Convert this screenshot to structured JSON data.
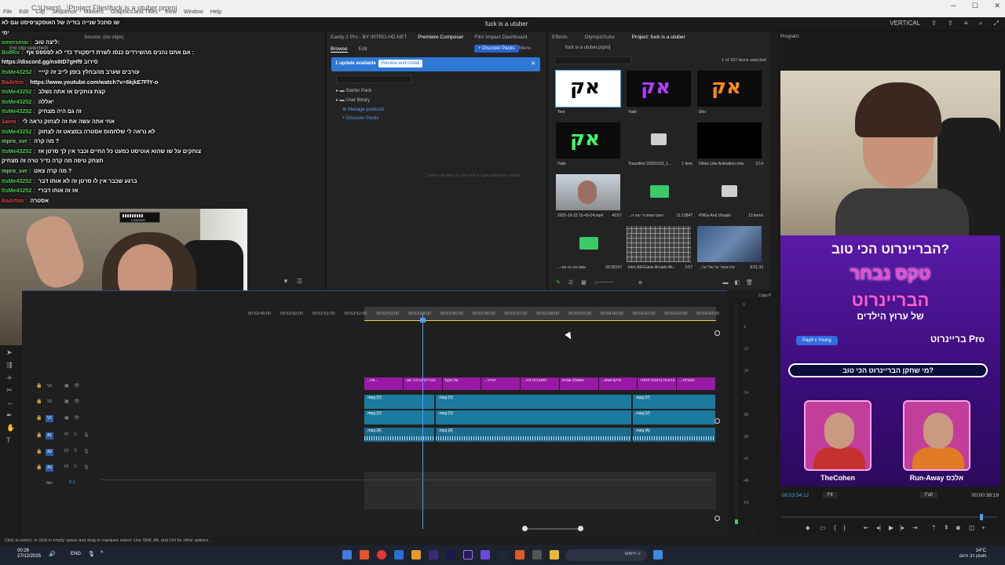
{
  "window": {
    "title": "fuck is a utuber",
    "path": "C:\\Users\\...\\Project Files\\fuck is a utuber.prproj",
    "menu": [
      "File",
      "Edit",
      "Clip",
      "Sequence",
      "Markers",
      "Graphics and Titles",
      "View",
      "Window",
      "Help"
    ],
    "workspace_right": "VERTICAL"
  },
  "chat": [
    {
      "user": "",
      "msg": "שו סתכל שנייה בודיה של האוסקציפיסט וגם לא ",
      "color": "red"
    },
    {
      "user": "",
      "msg": "ימי",
      "color": "red"
    },
    {
      "user": "omersinai",
      "msg": "ליצה טוב:",
      "color": "green"
    },
    {
      "user": "BotRix",
      "msg": "אם אתם נהנים מהשירדים כנסו לשרת דיסקורד כדי לא לפספס אף :",
      "color": "green"
    },
    {
      "user": "",
      "msg": "https://discord.gg/ns6tD7gHf9 סירוב",
      "color": "green"
    },
    {
      "user": "ItsMe43252",
      "msg": "עורבים שערב מהבחלץ בזמן לייב זה קיייי",
      "color": "green"
    },
    {
      "user": "BaArtim",
      "msg": "https://www.youtube.com/watch?v=6kjkE7FfY-o",
      "color": "red"
    },
    {
      "user": "ItsMe43252",
      "msg": "קצת צוחקים אז אתה נשלב",
      "color": "green"
    },
    {
      "user": "ItsMe43252",
      "msg": "יאללה",
      "color": "green"
    },
    {
      "user": "ItsMe43252",
      "msg": "זה גם היה מצחיק",
      "color": "green"
    },
    {
      "user": "1avni",
      "msg": "אחי אתה עשה את זה לצחוק נראה לי",
      "color": "red"
    },
    {
      "user": "ItsMe43252",
      "msg": "לא נראה לי שלחמוס אסטרה במצאט זה לצחוק",
      "color": "green"
    },
    {
      "user": "mpro_svr",
      "msg": "מה קרה ?",
      "color": "green2"
    },
    {
      "user": "ItsMe43252",
      "msg": "צוחקים על שו שהוא אוטיסט כמעט כל החיים וכבר אין לך סרטן אז",
      "color": "green"
    },
    {
      "user": "",
      "msg": "תצחק טיפה מה קרה נדיר טרה זה מצחיק",
      "color": "green"
    },
    {
      "user": "mpro_svr",
      "msg": "מה קרה צאט ?",
      "color": "green2"
    },
    {
      "user": "ItsMe43252",
      "msg": "ברגע שכבר אין לו סרטן זה לא אותו דבר",
      "color": "green"
    },
    {
      "user": "ItsMe43252",
      "msg": "*אז זה אותו דבר",
      "color": "green"
    },
    {
      "user": "BaArtim",
      "msg": "אסטרה",
      "color": "red"
    }
  ],
  "webcam_overlay": "LOADING",
  "source_panel": {
    "tabs": "Source: (no clips)",
    "label": "(no clip selected)"
  },
  "ext_panel": {
    "tabs": [
      "Easily 2 Pro - BY INTRO-HD.NET",
      "Premiere Composer",
      "Film Impact Dashboard"
    ],
    "sub_tabs": [
      "Browse",
      "Edit"
    ],
    "discover_btn": "+ Discover Packs",
    "menu_label": "Menu",
    "update_text": "1 update available",
    "update_btn": "Review and install",
    "tree": [
      "Starter Pack",
      "User library",
      "Manage products",
      "Discover Packs"
    ],
    "empty_hint": "Select an item on the left or type above to search"
  },
  "proj_panel": {
    "tabs": [
      "Effects",
      "OlympicSubs",
      "Project: fuck is a utuber"
    ],
    "path": "fuck is a utuber.prproj",
    "selected_count": "1 of 167 items selected",
    "items": [
      {
        "name": "Text",
        "dur": "",
        "kind": "ak",
        "color": "#ffffff"
      },
      {
        "name": "Yakir",
        "dur": "",
        "kind": "ak",
        "color": "#b23bff"
      },
      {
        "name": "Sho",
        "dur": "",
        "kind": "ak",
        "color": "#ff8a1c"
      },
      {
        "name": "Yakir",
        "dur": "",
        "kind": "ak",
        "color": "#3cff6a"
      },
      {
        "name": "Transition 20251023_1...",
        "dur": "1 Item",
        "kind": "folder",
        "color": ""
      },
      {
        "name": "Ofeks Like Animation.mov",
        "dur": "3:14",
        "kind": "black",
        "color": ""
      },
      {
        "name": "2025-10-23 15-43-24.mp4",
        "dur": "42:07",
        "kind": "cam",
        "color": ""
      },
      {
        "name": "...האם השחרור יצא ה",
        "dur": "11:12847",
        "kind": "audio",
        "color": ""
      },
      {
        "name": "PNGs And Visuals",
        "dur": "13 items",
        "kind": "folder",
        "color": ""
      },
      {
        "name": "...מה ננו עוד wav",
        "dur": "20:35147",
        "kind": "audio",
        "color": ""
      },
      {
        "name": "Intro AE/Game Arcade Alt...",
        "dur": "3:57",
        "kind": "grid",
        "color": ""
      },
      {
        "name": "...את אומר על שלי על",
        "dur": "8:51:33",
        "kind": "game",
        "color": ""
      }
    ]
  },
  "timeline": {
    "ticks": [
      "00:53:49:00",
      "00:53:50:00",
      "00:53:51:00",
      "00:53:52:00",
      "00:53:53:00",
      "00:53:54:00",
      "00:53:55:00",
      "00:53:56:00",
      "00:53:57:00",
      "00:53:58:00",
      "00:53:59:00",
      "00:54:00:00",
      "00:54:01:00",
      "00:54:02:00",
      "00:54:03:00"
    ],
    "tracks": [
      "V3",
      "V2",
      "V1",
      "A1",
      "A2",
      "A3",
      "Mix"
    ],
    "mix_value": "0.0",
    "title_clips": [
      "...פה...",
      "הבריינרוט הכי טוב",
      "של טקס",
      "...הגייני",
      "...הסטורות פה",
      "השאלה שהיא",
      "...מייקראפט",
      "ברוכות ברוכות תחזרו",
      "...סטורות"
    ],
    "video_clip_label": ".mpg [V]",
    "audio_clip_label": ".mpg [A]",
    "meter_ticks": [
      "0",
      "-6",
      "-12",
      "-18",
      "-24",
      "-30",
      "-36",
      "-42",
      "-48",
      "-54"
    ]
  },
  "program": {
    "label": "Program:",
    "timecode": "00:53:54:12",
    "fit": "Fit",
    "quality": "Full",
    "duration": "00:00:36:19",
    "copy_label": "Copy P",
    "thumbnail": {
      "question": "הבריינרוט הכי טוב?",
      "title1": "טקס נבחר",
      "title2": "הבריינרוט",
      "subtitle": "של ערוץ הילדים",
      "pro": "בריינרוט Pro",
      "pay": "Pay8 x Young",
      "bar": "מי שחקן הבריינרוט הכי טוב?",
      "player1": "TheCohen",
      "player2": "Run-Away אלכס"
    }
  },
  "status": "Click to select, or click in empty space and drag to marquee select. Use Shift, Alt, and Ctrl for other options.",
  "taskbar": {
    "time": "00:26",
    "date": "27/12/2025",
    "lang": "ENG",
    "search": "חיפוש",
    "weather_temp": "14°C",
    "weather_desc": "מעונן רב היום"
  }
}
